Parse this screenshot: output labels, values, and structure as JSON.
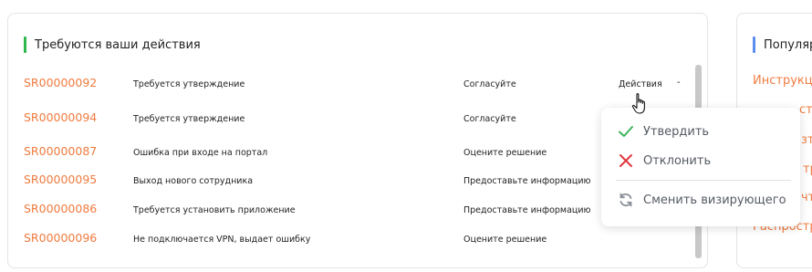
{
  "main_panel": {
    "title": "Требуются ваши действия",
    "accent_color": "#2db84d",
    "rows": [
      {
        "id": "SR00000092",
        "description": "Требуется утверждение",
        "action": "Согласуйте",
        "menu": "Действия",
        "dash": "-"
      },
      {
        "id": "SR00000094",
        "description": "Требуется утверждение",
        "action": "Согласуйте",
        "menu": "",
        "dash": ""
      },
      {
        "id": "SR00000087",
        "description": "Ошибка при входе на портал",
        "action": "Оцените решение",
        "menu": "",
        "dash": ""
      },
      {
        "id": "SR00000095",
        "description": "Выход нового сотрудника",
        "action": "Предоставьте информацию",
        "menu": "",
        "dash": ""
      },
      {
        "id": "SR00000086",
        "description": "Требуется установить приложение",
        "action": "Предоставьте информацию",
        "menu": "",
        "dash": ""
      },
      {
        "id": "SR00000096",
        "description": "Не подключается VPN, выдает ошибку",
        "action": "Оцените решение",
        "menu": "",
        "dash": ""
      }
    ]
  },
  "side_panel": {
    "title": "Популяр",
    "accent_color": "#5b8def",
    "links": [
      "Инструкци",
      "ста",
      "зтв",
      "тр",
      "чтс",
      "Распростр"
    ]
  },
  "dropdown": {
    "items": [
      {
        "label": "Утвердить",
        "icon": "check-icon",
        "color": "#3cb55a"
      },
      {
        "label": "Отклонить",
        "icon": "x-icon",
        "color": "#e0383e"
      },
      {
        "label": "Сменить визирующего",
        "icon": "swap-icon",
        "color": "#8a8f97"
      }
    ]
  },
  "link_color": "#f07b3f"
}
